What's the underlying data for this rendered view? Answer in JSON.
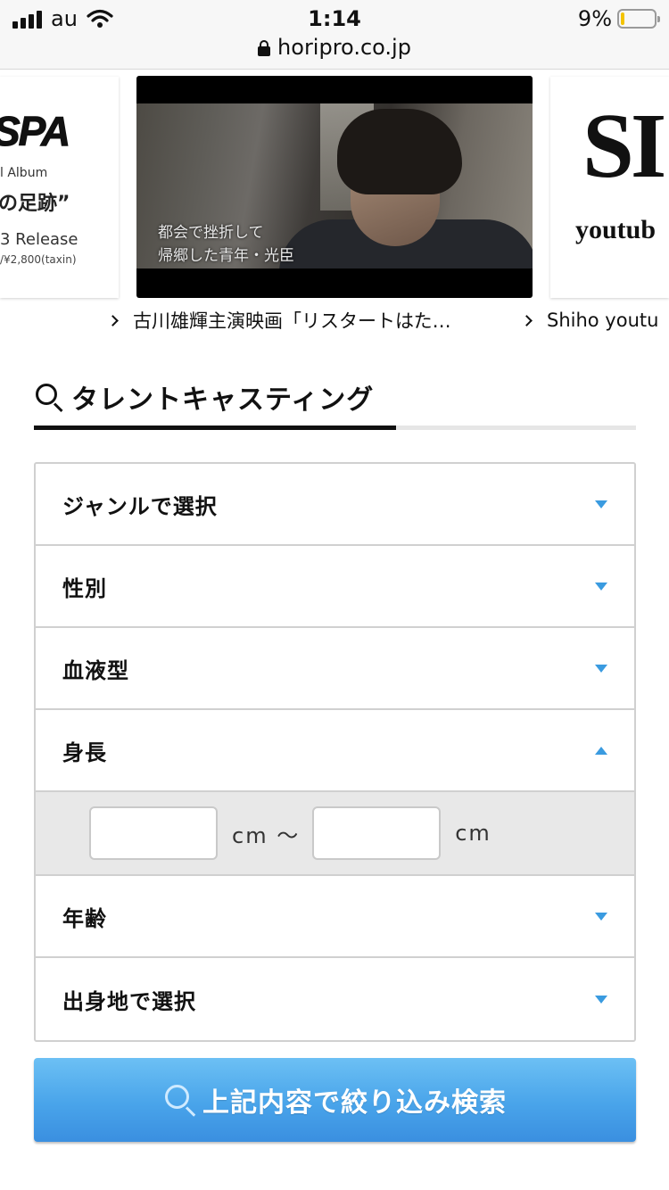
{
  "status_bar": {
    "carrier": "au",
    "time": "1:14",
    "battery_percent": "9%",
    "battery_level": 0.09,
    "battery_color": "#f3c300"
  },
  "browser": {
    "url": "horipro.co.jp"
  },
  "banners": {
    "left": {
      "logo": "SPA",
      "album": "l Album",
      "title": "の足跡”",
      "release": "3 Release",
      "price": "/¥2,800(taxin)"
    },
    "video": {
      "subtitle_line1": "都会で挫折して",
      "subtitle_line2": "帰郷した青年・光臣"
    },
    "right": {
      "logo": "SI",
      "sub": "youtub"
    },
    "captions": [
      "古川雄輝主演映画「リスタートはた…",
      "Shiho youtu"
    ]
  },
  "section": {
    "title": "タレントキャスティング",
    "accent_color": "#3a9be0"
  },
  "filters": {
    "genre": "ジャンルで選択",
    "gender": "性別",
    "blood_type": "血液型",
    "height": "身長",
    "height_unit": "cm",
    "height_separator": "〜",
    "height_min_value": "",
    "height_max_value": "",
    "age": "年齢",
    "birthplace": "出身地で選択"
  },
  "search_button": {
    "label": "上記内容で絞り込み検索"
  }
}
